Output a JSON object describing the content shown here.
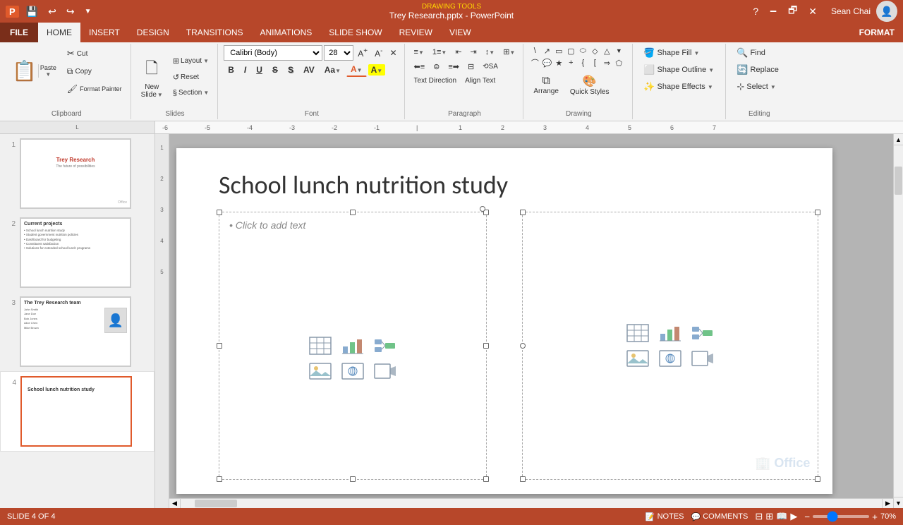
{
  "titlebar": {
    "title": "Trey Research.pptx - PowerPoint",
    "drawing_tools": "DRAWING TOOLS",
    "user": "Sean Chai",
    "save_icon": "💾",
    "undo_icon": "↩",
    "redo_icon": "↪"
  },
  "tabs": {
    "file": "FILE",
    "home": "HOME",
    "insert": "INSERT",
    "design": "DESIGN",
    "transitions": "TRANSITIONS",
    "animations": "ANIMATIONS",
    "slideshow": "SLIDE SHOW",
    "review": "REVIEW",
    "view": "VIEW",
    "format": "FORMAT"
  },
  "ribbon": {
    "clipboard": {
      "label": "Clipboard",
      "paste": "Paste",
      "cut": "Cut",
      "copy": "Copy",
      "format_painter": "Format Painter"
    },
    "slides": {
      "label": "Slides",
      "new_slide": "New\nSlide",
      "layout": "Layout",
      "reset": "Reset",
      "section": "Section"
    },
    "font": {
      "label": "Font",
      "face": "Calibri (Body)",
      "size": "28",
      "grow": "A",
      "shrink": "A",
      "bold": "B",
      "italic": "I",
      "underline": "U",
      "strikethrough": "S",
      "shadow": "S",
      "char_spacing": "AV",
      "font_color": "A",
      "clear": "🧹",
      "change_case": "Aa"
    },
    "paragraph": {
      "label": "Paragraph",
      "bullets": "≡",
      "numbering": "≡",
      "decrease_indent": "←",
      "increase_indent": "→",
      "line_spacing": "↕",
      "text_direction": "Text Direction",
      "align_text": "Align Text",
      "convert_smartart": "Convert to SmartArt",
      "align_left": "≡",
      "center": "≡",
      "align_right": "≡",
      "justify": "≡",
      "columns": "⊞"
    },
    "drawing": {
      "label": "Drawing",
      "arrange": "Arrange",
      "quick_styles": "Quick\nStyles"
    },
    "shape_format": {
      "label": "",
      "shape_fill": "Shape Fill",
      "shape_outline": "Shape Outline",
      "shape_effects": "Shape Effects"
    },
    "editing": {
      "label": "Editing",
      "find": "Find",
      "replace": "Replace",
      "select": "Select"
    }
  },
  "slides": [
    {
      "num": "1",
      "title": "Trey Research",
      "subtitle": "The future of possibilities"
    },
    {
      "num": "2",
      "title": "Current projects",
      "lines": [
        "School lunch nutrition study",
        "Student government nutrition policies",
        "Dashboard for budgeting",
        "Constituent satisfaction",
        "Solutions for extended school lunch programs"
      ]
    },
    {
      "num": "3",
      "title": "The Trey Research team",
      "has_photo": true
    },
    {
      "num": "4",
      "title": "School lunch nutrition study",
      "active": true
    }
  ],
  "canvas": {
    "slide_title": "School lunch nutrition study",
    "content_placeholder": "• Click to add text"
  },
  "statusbar": {
    "slide_info": "SLIDE 4 OF 4",
    "notes": "NOTES",
    "comments": "COMMENTS",
    "zoom": "70%",
    "zoom_value": 70
  }
}
